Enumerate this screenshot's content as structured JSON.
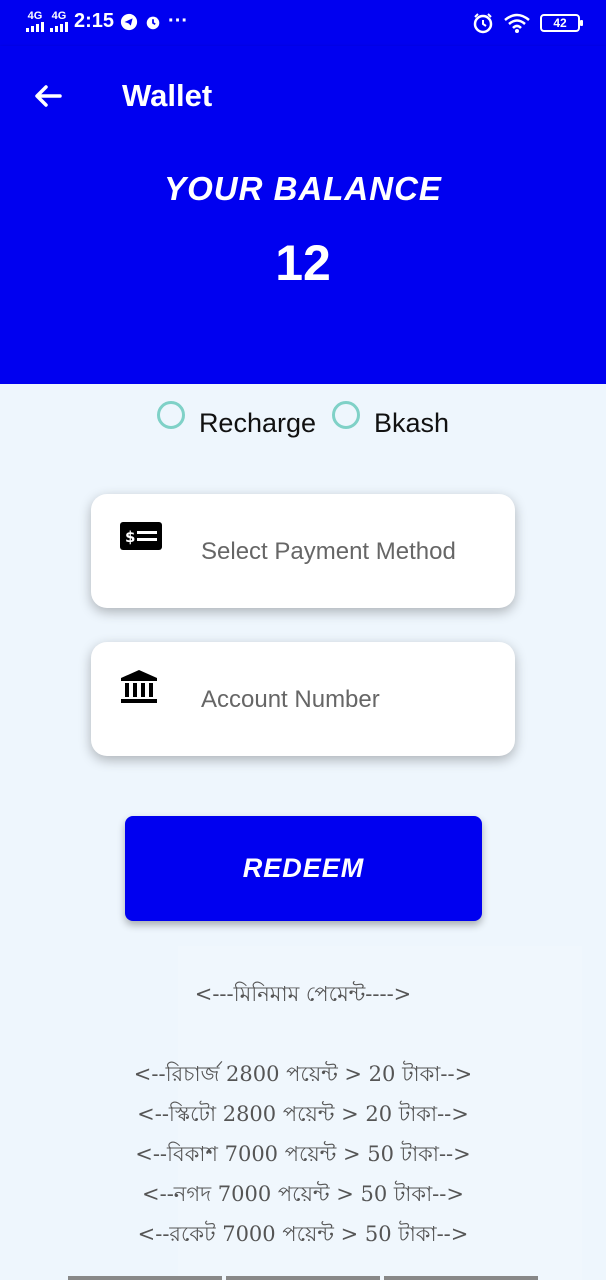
{
  "status_bar": {
    "network_1": "4G",
    "network_2": "4G",
    "time": "2:15",
    "more": "···",
    "battery": "42",
    "icons": [
      "telegram-icon",
      "alarm-icon",
      "wifi-icon",
      "battery-icon"
    ]
  },
  "app_bar": {
    "title": "Wallet",
    "back_icon": "arrow-left-icon"
  },
  "balance": {
    "label": "YOUR BALANCE",
    "value": "12"
  },
  "payment_type": {
    "options": [
      {
        "label": "Recharge",
        "selected": false
      },
      {
        "label": "Bkash",
        "selected": false
      }
    ]
  },
  "form": {
    "payment_method_placeholder": "Select Payment Method",
    "account_number_placeholder": "Account Number"
  },
  "redeem": {
    "label": "REDEEM"
  },
  "info": {
    "header": "<---মিনিমাম পেমেন্ট---->",
    "lines": [
      "<--রিচার্জ 2800 পয়েন্ট > 20 টাকা-->",
      "<--স্কিটো 2800 পয়েন্ট > 20 টাকা-->",
      "<--বিকাশ 7000 পয়েন্ট > 50 টাকা-->",
      "<--নগদ 7000 পয়েন্ট > 50 টাকা-->",
      "<--রকেট 7000 পয়েন্ট > 50 টাকা-->"
    ]
  },
  "colors": {
    "primary": "#0000f0",
    "background": "#eef6fd",
    "radio": "#7fd1c7"
  }
}
